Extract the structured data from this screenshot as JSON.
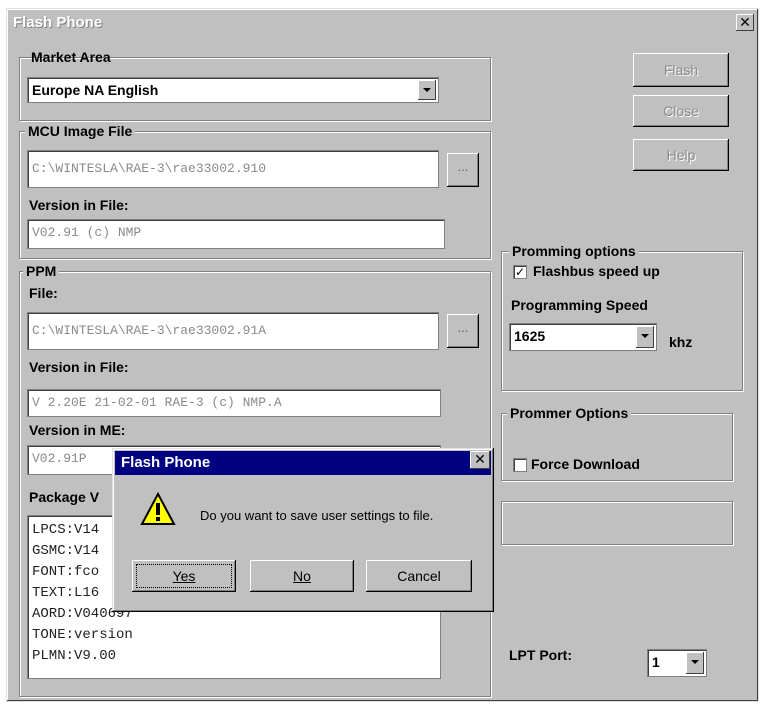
{
  "window": {
    "title": "Flash Phone",
    "close": "✕"
  },
  "buttons": {
    "flash": "Flash",
    "close": "Close",
    "help": "Help"
  },
  "market_area": {
    "label": "Market Area",
    "selected": "Europe NA English"
  },
  "mcu": {
    "group_label": "MCU Image File",
    "file": "C:\\WINTESLA\\RAE-3\\rae33002.910",
    "version_label": "Version in File:",
    "version": "V02.91 (c) NMP",
    "browse": "..."
  },
  "ppm": {
    "group_label": "PPM",
    "file_label": "File:",
    "file": "C:\\WINTESLA\\RAE-3\\rae33002.91A",
    "browse": "...",
    "version_file_label": "Version in File:",
    "version_file": "V 2.20E 21-02-01 RAE-3 (c) NMP.A",
    "version_me_label": "Version in ME:",
    "version_me": "V02.91P"
  },
  "package": {
    "label": "Package V",
    "lines": [
      "LPCS:V14",
      "GSMC:V14",
      "FONT:fco",
      "TEXT:L16",
      "AORD:V040697",
      "TONE:version",
      "PLMN:V9.00"
    ]
  },
  "promming": {
    "group_label": "Promming options",
    "flashbus_label": "Flashbus speed up",
    "flashbus_checked": "✓",
    "speed_label": "Programming Speed",
    "speed": "1625",
    "unit": "khz"
  },
  "prommer": {
    "group_label": "Prommer Options",
    "force_label": "Force Download"
  },
  "lpt": {
    "label": "LPT Port:",
    "value": "1"
  },
  "dialog": {
    "title": "Flash Phone",
    "close": "✕",
    "message": "Do you want to save user settings to file.",
    "yes": "Yes",
    "no": "No",
    "cancel": "Cancel"
  }
}
